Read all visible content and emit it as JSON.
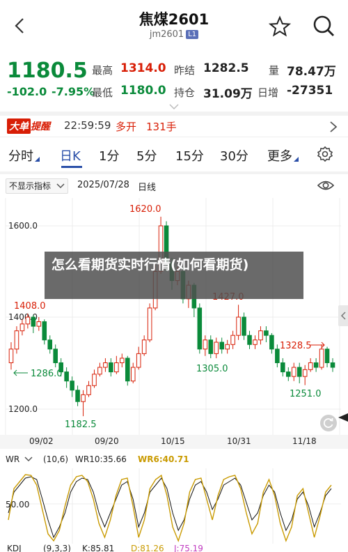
{
  "header": {
    "title": "焦煤2601",
    "subtitle": "jm2601",
    "badge": "L1",
    "icons": [
      "back-icon",
      "star-icon",
      "search-icon"
    ]
  },
  "quote": {
    "price": "1180.5",
    "change": "-102.0",
    "change_pct": "-7.95%",
    "high_label": "最高",
    "high": "1314.0",
    "low_label": "最低",
    "low": "1180.0",
    "prev_close_label": "昨结",
    "prev_close": "1282.5",
    "open_interest_label": "持仓",
    "open_interest": "31.09万",
    "volume_label": "量",
    "volume": "78.47万",
    "daily_change_label": "日增",
    "daily_change": "-27351"
  },
  "alert": {
    "logo_a": "大单",
    "logo_b": "提醒",
    "time": "22:59:59",
    "type": "多开",
    "amount": "131手"
  },
  "tabs": [
    {
      "label": "分时"
    },
    {
      "label": "日K"
    },
    {
      "label": "1分"
    },
    {
      "label": "5分"
    },
    {
      "label": "15分"
    },
    {
      "label": "30分"
    },
    {
      "label": "更多"
    }
  ],
  "chart": {
    "indicator_select": "不显示指标",
    "date": "2025/07/28",
    "period": "日线",
    "price_ticks": [
      "1600.0",
      "1400.0",
      "1200.0"
    ],
    "x_labels": [
      "09/02",
      "09/20",
      "10/15",
      "10/31",
      "11/18"
    ],
    "annotations": {
      "high": "1620.0",
      "left_high": "1408.0",
      "left_level": "1286.0",
      "left_low": "1182.5",
      "mid_high": "1427.0",
      "mid_low": "1305.0",
      "right_level": "1328.5",
      "right_low": "1251.0"
    }
  },
  "wr": {
    "name": "WR",
    "params": "(10,6)",
    "wr1": "WR10:35.66",
    "wr2": "WR6:40.71",
    "level": "50.00"
  },
  "kdj": {
    "name": "KDJ",
    "params": "(9,3,3)",
    "k": "K:85.81",
    "d": "D:81.26",
    "j": "J:75.19"
  },
  "banner": {
    "text": "怎么看期货实时行情(如何看期货)"
  },
  "colors": {
    "up": "#d81e06",
    "down": "#0a8a3a",
    "accent": "#2a4fa8",
    "wr_line2": "#c99a00"
  }
}
